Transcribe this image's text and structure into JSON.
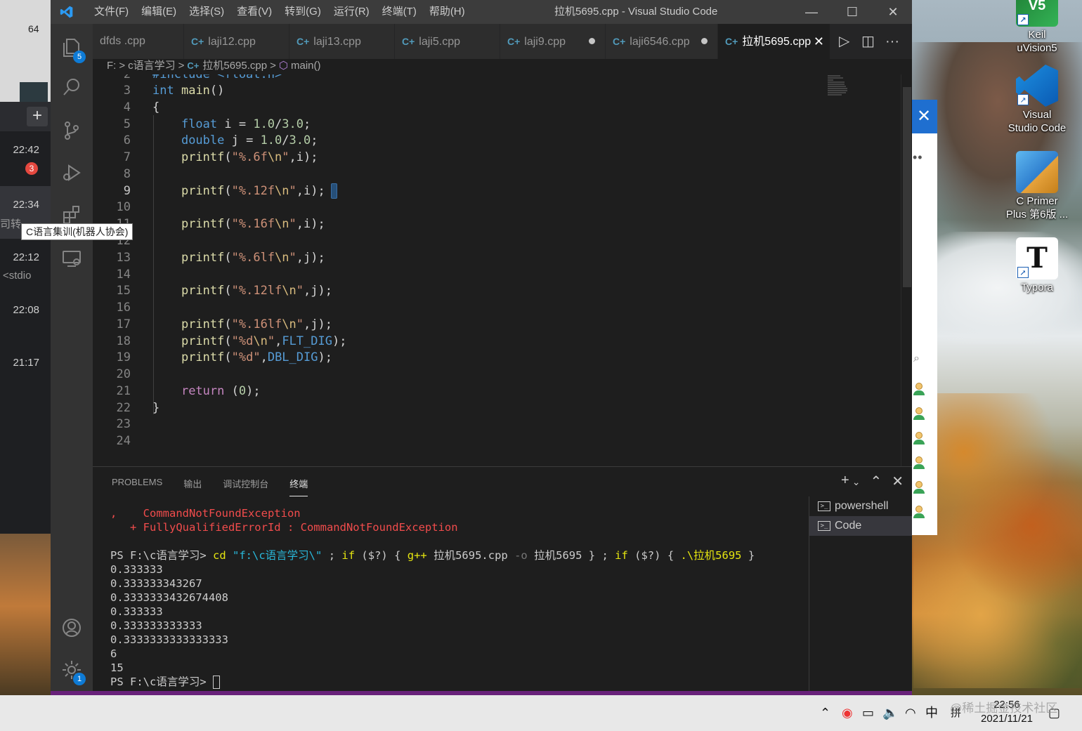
{
  "window": {
    "title": "拉机5695.cpp - Visual Studio Code"
  },
  "menu": [
    "文件(F)",
    "编辑(E)",
    "选择(S)",
    "查看(V)",
    "转到(G)",
    "运行(R)",
    "终端(T)",
    "帮助(H)"
  ],
  "activity_badges": {
    "explorer": "5",
    "settings": "1"
  },
  "tabs": [
    {
      "label": "dfds .cpp",
      "dirty": false,
      "active": false
    },
    {
      "label": "laji12.cpp",
      "dirty": false,
      "active": false
    },
    {
      "label": "laji13.cpp",
      "dirty": false,
      "active": false
    },
    {
      "label": "laji5.cpp",
      "dirty": false,
      "active": false
    },
    {
      "label": "laji9.cpp",
      "dirty": true,
      "active": false
    },
    {
      "label": "laji6546.cpp",
      "dirty": true,
      "active": false
    },
    {
      "label": "拉机5695.cpp",
      "dirty": false,
      "active": true
    }
  ],
  "breadcrumb": {
    "drive": "F:",
    "folder": "c语言学习",
    "file": "拉机5695.cpp",
    "symbol": "main()"
  },
  "editor": {
    "line_numbers": [
      "2",
      "3",
      "4",
      "5",
      "6",
      "7",
      "8",
      "9",
      "10",
      "11",
      "12",
      "13",
      "14",
      "15",
      "16",
      "17",
      "18",
      "19",
      "20",
      "21",
      "22",
      "23",
      "24"
    ],
    "partial_top_line": "#include <float.h>"
  },
  "panel": {
    "tabs": [
      "PROBLEMS",
      "输出",
      "调试控制台",
      "终端"
    ],
    "active_tab": "终端",
    "terminal_list": [
      "powershell",
      "Code"
    ],
    "terminal_lines": {
      "err1_prefix": ",",
      "err1": "CommandNotFoundException",
      "err2": "+ FullyQualifiedErrorId : CommandNotFoundException",
      "prompt": "PS F:\\c语言学习>",
      "cmd_cd": "cd",
      "cmd_path": "\"f:\\c语言学习\\\"",
      "cmd_rest1": ";",
      "cmd_if1": "if",
      "cmd_cond1": "($?)",
      "cmd_brace1": "{",
      "cmd_gpp": "g++",
      "cmd_src": "拉机5695.cpp",
      "cmd_o": "-o",
      "cmd_out": "拉机5695",
      "cmd_brace2": "} ;",
      "cmd_if2": "if",
      "cmd_cond2": "($?)",
      "cmd_brace3": "{",
      "cmd_run": ".\\拉机5695",
      "cmd_brace4": "}",
      "outputs": [
        "0.333333",
        "0.333333343267",
        "0.3333333432674408",
        "0.333333",
        "0.333333333333",
        "0.3333333333333333",
        "6",
        "15"
      ],
      "final_prompt": "PS F:\\c语言学习>"
    }
  },
  "chat_panel": {
    "items": [
      {
        "time": "22:42",
        "badge": "3",
        "preview": ""
      },
      {
        "time": "22:34",
        "badge": "",
        "preview": "司转"
      },
      {
        "time": "22:12",
        "badge": "",
        "preview": "<stdio"
      },
      {
        "time": "22:08",
        "badge": "",
        "preview": ""
      },
      {
        "time": "21:17",
        "badge": "",
        "preview": ""
      }
    ],
    "tooltip": "C语言集训(机器人协会)",
    "top_number": "64"
  },
  "desktop_icons": [
    {
      "label_line1": "Keil",
      "label_line2": "uVision5",
      "icon": "keil-icon",
      "glyph": "V5"
    },
    {
      "label_line1": "Visual",
      "label_line2": "Studio Code",
      "icon": "vscode-icon",
      "glyph": ""
    },
    {
      "label_line1": "C Primer",
      "label_line2": "Plus 第6版 ...",
      "icon": "winrar-book-icon",
      "glyph": ""
    },
    {
      "label_line1": "Typora",
      "label_line2": "",
      "icon": "typora-icon",
      "glyph": "T"
    }
  ],
  "taskbar": {
    "ime": "中",
    "ime2": "拼",
    "time": "22:56",
    "date": "2021/11/21"
  },
  "watermark": "@稀土掘金技术社区",
  "colors": {
    "accent": "#68217a",
    "keyword": "#569cd6",
    "string": "#ce9178",
    "number": "#b5cea8",
    "function": "#dcdcaa",
    "error": "#f14c4c"
  }
}
